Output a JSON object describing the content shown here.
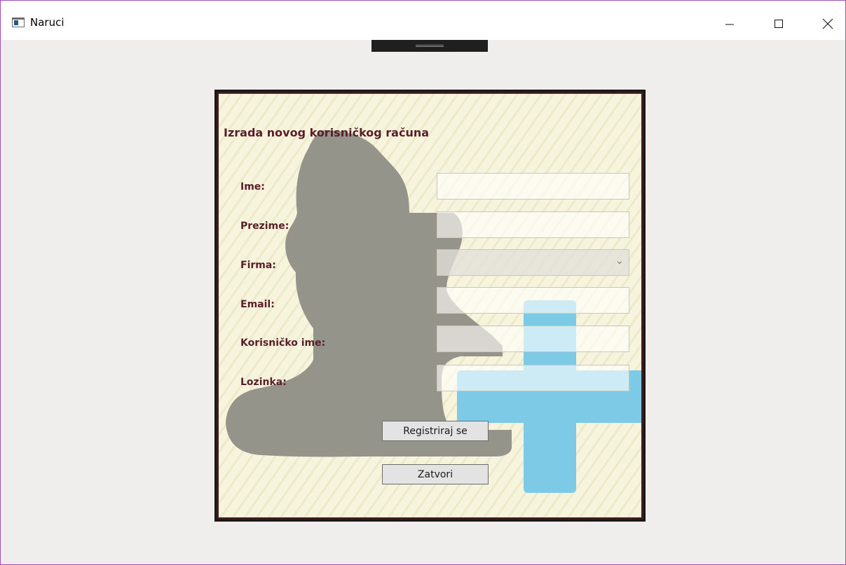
{
  "window": {
    "title": "Naruci",
    "controls": {
      "minimize": "minimize-icon",
      "maximize": "maximize-icon",
      "close": "close-icon"
    }
  },
  "form": {
    "title": "Izrada novog korisničkog računa",
    "fields": [
      {
        "label": "Ime:",
        "value": "",
        "type": "text"
      },
      {
        "label": "Prezime:",
        "value": "",
        "type": "text"
      },
      {
        "label": "Firma:",
        "value": "",
        "type": "select"
      },
      {
        "label": "Email:",
        "value": "",
        "type": "text"
      },
      {
        "label": "Korisničko ime:",
        "value": "",
        "type": "text"
      },
      {
        "label": "Lozinka:",
        "value": "",
        "type": "password"
      }
    ],
    "buttons": {
      "register": "Registriraj se",
      "close": "Zatvori"
    }
  },
  "colors": {
    "accent_border": "#9b4fb3",
    "label_text": "#5a1e2a",
    "panel_background": "#f6f4dc",
    "person_silhouette": "#95948a",
    "plus_sign": "#7ccae6"
  }
}
